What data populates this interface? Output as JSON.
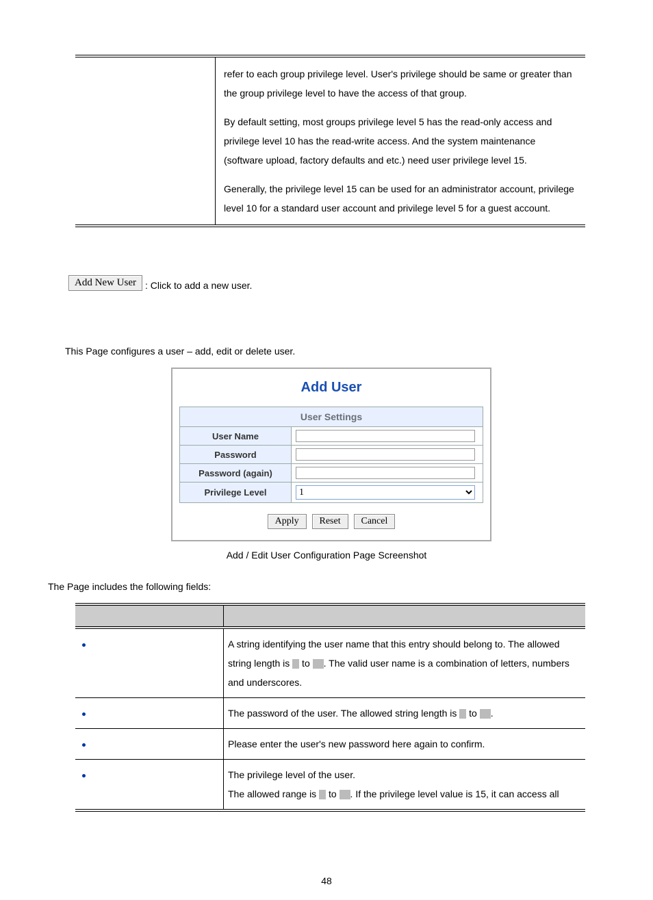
{
  "top_cell": {
    "p1": "refer to each group privilege level. User's privilege should be same or greater than the group privilege level to have the access of that group.",
    "p2": "By default setting, most groups privilege level 5 has the read-only access and privilege level 10 has the read-write access. And the system maintenance (software upload, factory defaults and etc.) need user privilege level 15.",
    "p3": "Generally, the privilege level 15 can be used for an administrator account, privilege level 10 for a standard user account and privilege level 5 for a guest account."
  },
  "add_btn_label": "Add New User",
  "add_btn_desc": ": Click to add a new user.",
  "config_line": "This Page configures a user – add, edit or delete user.",
  "form": {
    "title": "Add User",
    "section": "User Settings",
    "rows": {
      "username": "User Name",
      "password": "Password",
      "password2": "Password (again)",
      "privlevel": "Privilege Level"
    },
    "priv_value": "1",
    "apply": "Apply",
    "reset": "Reset",
    "cancel": "Cancel"
  },
  "caption": "Add / Edit User Configuration Page Screenshot",
  "fields_intro": "The Page includes the following fields:",
  "fields": [
    {
      "desc_a": "A string identifying the user name that this entry should belong to. The allowed string length is ",
      "desc_b": " to ",
      "desc_c": ". The valid user name is a combination of letters, numbers and underscores."
    },
    {
      "desc_a": "The password of the user. The allowed string length is ",
      "desc_b": " to ",
      "desc_c": "."
    },
    {
      "desc_a": "Please enter the user's new password here again to confirm.",
      "desc_b": "",
      "desc_c": ""
    },
    {
      "line1": "The privilege level of the user.",
      "desc_a": "The allowed range is ",
      "desc_b": " to ",
      "desc_c": ". If the privilege level value is 15, it can access all"
    }
  ],
  "page_number": "48"
}
